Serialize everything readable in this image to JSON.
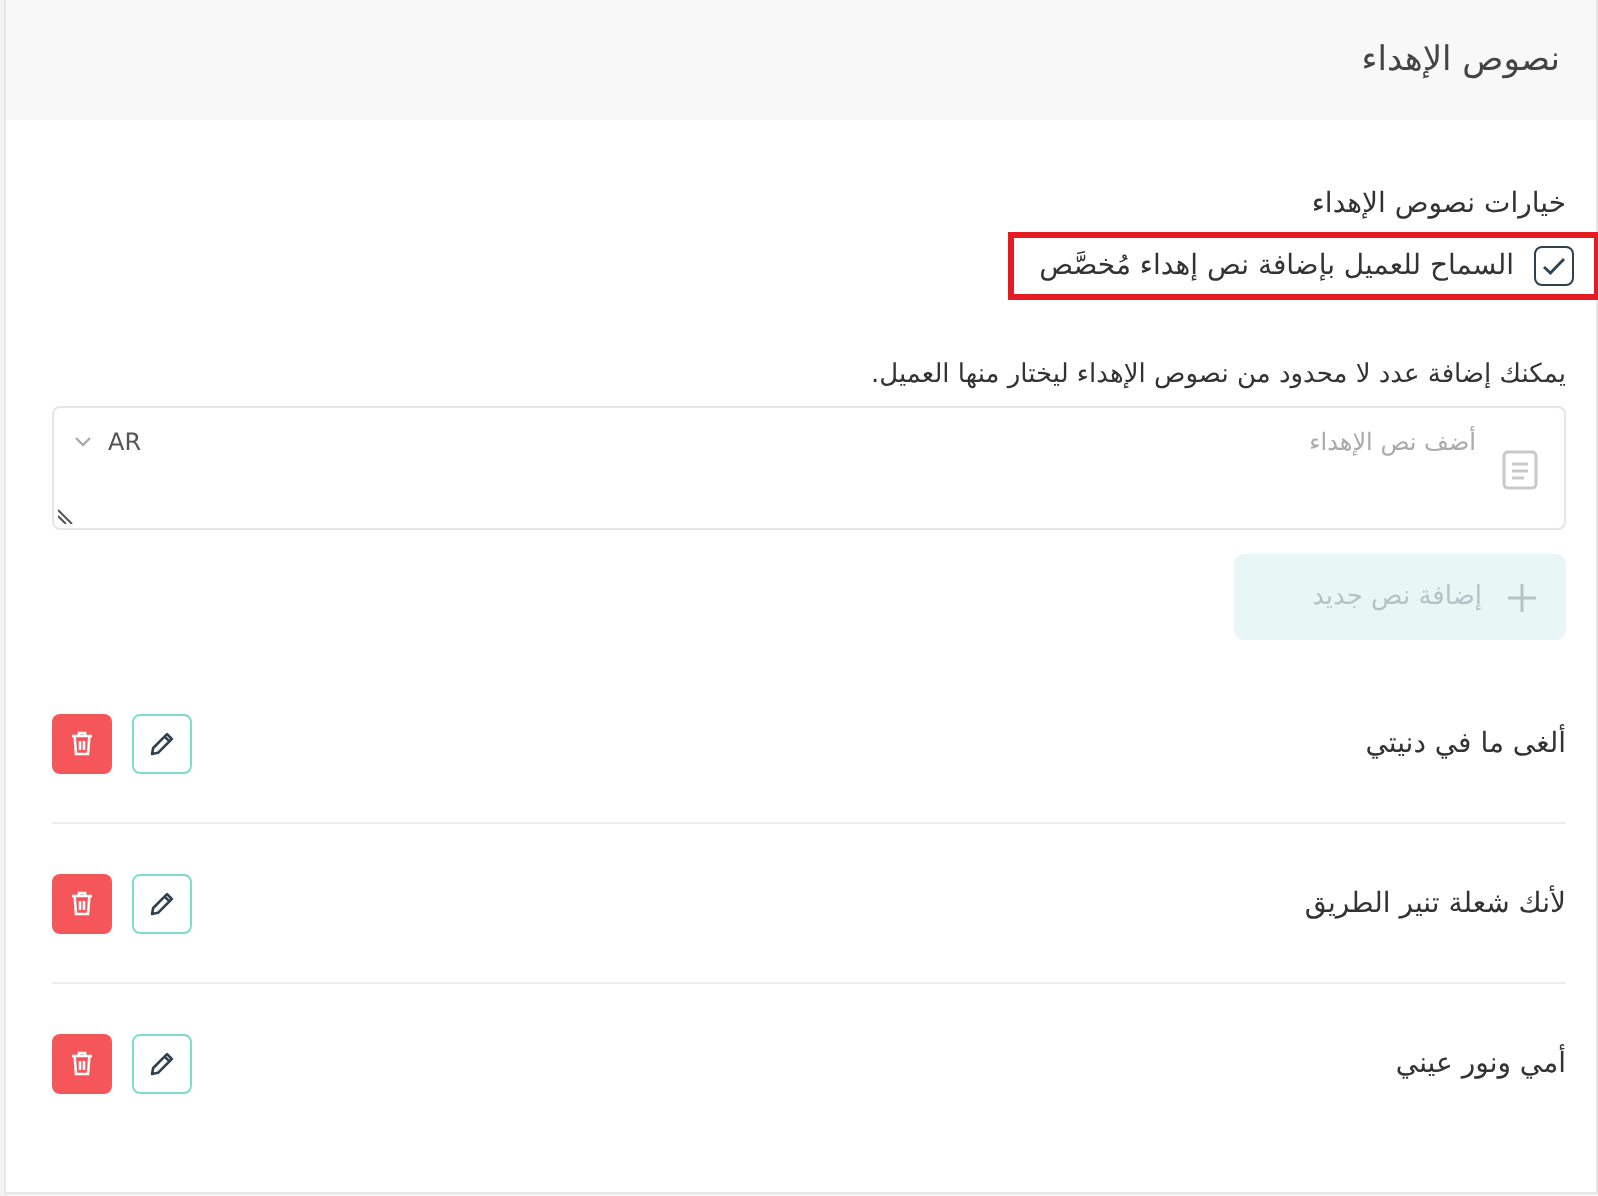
{
  "header": {
    "title": "نصوص الإهداء"
  },
  "options": {
    "heading": "خيارات نصوص الإهداء",
    "checkbox": {
      "label": "السماح للعميل بإضافة نص إهداء مُخصَّص",
      "checked": true,
      "highlighted": true
    }
  },
  "hint": "يمكنك إضافة عدد لا محدود من نصوص الإهداء ليختار منها العميل.",
  "input": {
    "placeholder": "أضف نص الإهداء",
    "language": "AR"
  },
  "add_button": {
    "label": "إضافة نص جديد",
    "disabled": true
  },
  "texts": [
    {
      "text": "ألغى ما في دنيتي"
    },
    {
      "text": "لأنك شعلة تنير الطريق"
    },
    {
      "text": "أمي ونور عيني"
    }
  ]
}
